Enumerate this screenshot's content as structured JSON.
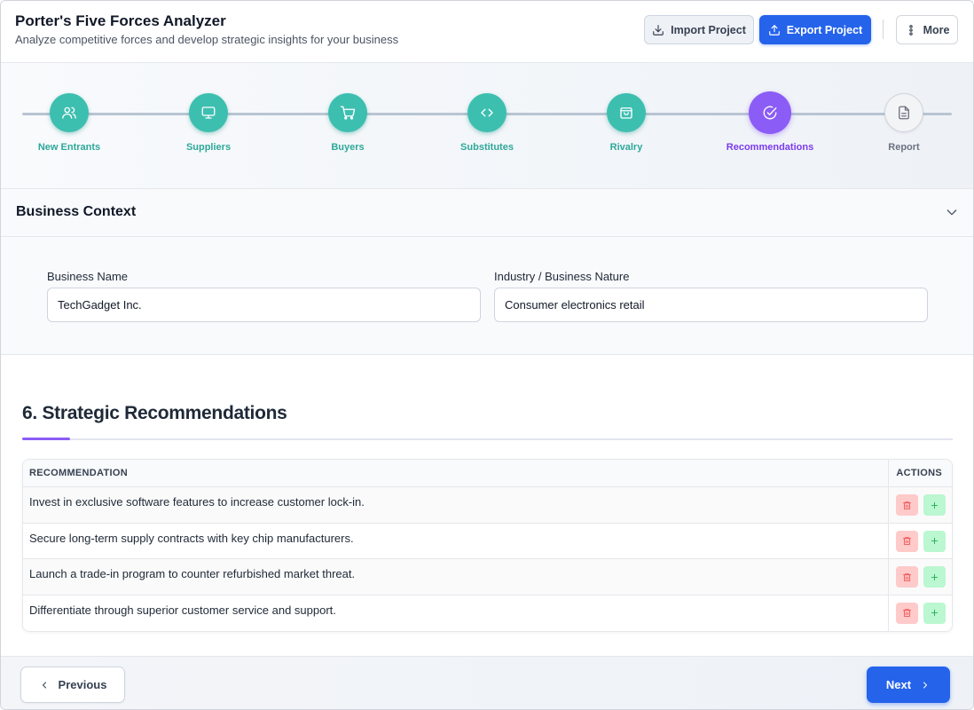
{
  "header": {
    "title": "Porter's Five Forces Analyzer",
    "subtitle": "Analyze competitive forces and develop strategic insights for your business",
    "import_label": "Import Project",
    "export_label": "Export Project",
    "more_label": "More"
  },
  "stepper": {
    "steps": [
      {
        "label": "New Entrants",
        "icon": "users-icon",
        "state": "completed"
      },
      {
        "label": "Suppliers",
        "icon": "monitor-icon",
        "state": "completed"
      },
      {
        "label": "Buyers",
        "icon": "cart-icon",
        "state": "completed"
      },
      {
        "label": "Substitutes",
        "icon": "code-icon",
        "state": "completed"
      },
      {
        "label": "Rivalry",
        "icon": "shopping-bag-icon",
        "state": "completed"
      },
      {
        "label": "Recommendations",
        "icon": "check-circle-icon",
        "state": "active"
      },
      {
        "label": "Report",
        "icon": "document-icon",
        "state": "pending"
      }
    ]
  },
  "context": {
    "title": "Business Context",
    "business_name_label": "Business Name",
    "business_name_value": "TechGadget Inc.",
    "industry_label": "Industry / Business Nature",
    "industry_value": "Consumer electronics retail"
  },
  "recommendations": {
    "title": "6. Strategic Recommendations",
    "col_recommendation": "RECOMMENDATION",
    "col_actions": "ACTIONS",
    "rows": [
      "Invest in exclusive software features to increase customer lock-in.",
      "Secure long-term supply contracts with key chip manufacturers.",
      "Launch a trade-in program to counter refurbished market threat.",
      "Differentiate through superior customer service and support."
    ]
  },
  "footer": {
    "previous_label": "Previous",
    "next_label": "Next"
  },
  "colors": {
    "completed": "#3dbfb0",
    "active": "#8b5cf6",
    "primary": "#2563eb"
  }
}
